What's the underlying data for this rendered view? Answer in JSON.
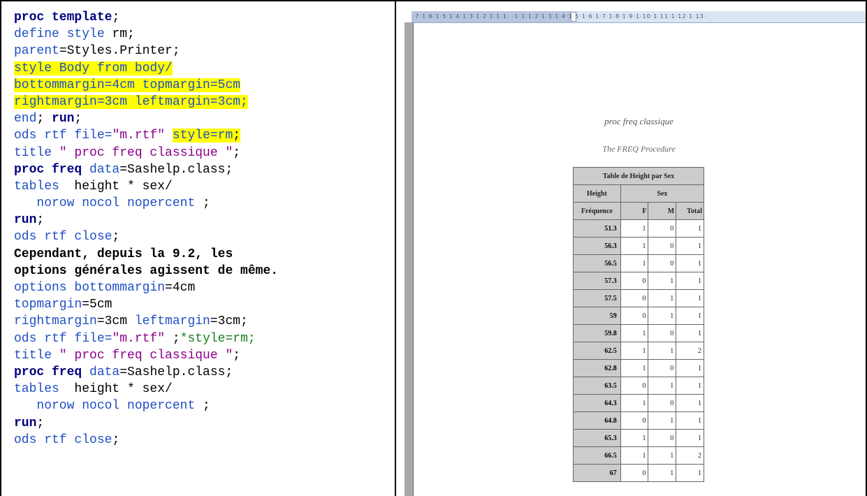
{
  "code_lines": [
    [
      {
        "t": "proc template",
        "c": "k"
      },
      {
        "t": ";",
        "c": ""
      }
    ],
    [
      {
        "t": "define style ",
        "c": "b"
      },
      {
        "t": "rm;",
        "c": ""
      }
    ],
    [
      {
        "t": "parent",
        "c": "b"
      },
      {
        "t": "=Styles.Printer;",
        "c": ""
      }
    ],
    [
      {
        "t": "style Body from body/",
        "c": "b hl"
      }
    ],
    [
      {
        "t": "bottommargin=4cm topmargin=5cm",
        "c": "b hl"
      }
    ],
    [
      {
        "t": "rightmargin=3cm leftmargin=3cm;",
        "c": "b hl"
      }
    ],
    [
      {
        "t": "end",
        "c": "b"
      },
      {
        "t": "; ",
        "c": ""
      },
      {
        "t": "run",
        "c": "k"
      },
      {
        "t": ";",
        "c": ""
      }
    ],
    [
      {
        "t": "ods rtf file=",
        "c": "b"
      },
      {
        "t": "\"m.rtf\"",
        "c": "s"
      },
      {
        "t": " ",
        "c": ""
      },
      {
        "t": "style=rm",
        "c": "b hl"
      },
      {
        "t": ";",
        "c": "hl"
      }
    ],
    [
      {
        "t": "title ",
        "c": "b"
      },
      {
        "t": "\" proc freq classique \"",
        "c": "s"
      },
      {
        "t": ";",
        "c": ""
      }
    ],
    [
      {
        "t": "proc freq",
        "c": "k"
      },
      {
        "t": " data",
        "c": "b"
      },
      {
        "t": "=Sashelp.class;",
        "c": ""
      }
    ],
    [
      {
        "t": "tables",
        "c": "b"
      },
      {
        "t": "  height * sex/",
        "c": ""
      }
    ],
    [
      {
        "t": "   norow nocol nopercent ",
        "c": "b"
      },
      {
        "t": ";",
        "c": ""
      }
    ],
    [
      {
        "t": "run",
        "c": "k"
      },
      {
        "t": ";",
        "c": ""
      }
    ],
    [
      {
        "t": "ods rtf close",
        "c": "b"
      },
      {
        "t": ";",
        "c": ""
      }
    ],
    [
      {
        "t": "Cependant, depuis la 9.2, les",
        "c": "kb"
      }
    ],
    [
      {
        "t": "options générales agissent de même.",
        "c": "kb"
      }
    ],
    [
      {
        "t": "options bottommargin",
        "c": "b"
      },
      {
        "t": "=4cm",
        "c": ""
      }
    ],
    [
      {
        "t": "topmargin",
        "c": "b"
      },
      {
        "t": "=5cm",
        "c": ""
      }
    ],
    [
      {
        "t": "rightmargin",
        "c": "b"
      },
      {
        "t": "=3cm ",
        "c": ""
      },
      {
        "t": "leftmargin",
        "c": "b"
      },
      {
        "t": "=3cm;",
        "c": ""
      }
    ],
    [
      {
        "t": "ods rtf file=",
        "c": "b"
      },
      {
        "t": "\"m.rtf\"",
        "c": "s"
      },
      {
        "t": " ;",
        "c": ""
      },
      {
        "t": "*style=rm;",
        "c": "g"
      }
    ],
    [
      {
        "t": "title ",
        "c": "b"
      },
      {
        "t": "\" proc freq classique \"",
        "c": "s"
      },
      {
        "t": ";",
        "c": ""
      }
    ],
    [
      {
        "t": "proc freq",
        "c": "k"
      },
      {
        "t": " data",
        "c": "b"
      },
      {
        "t": "=Sashelp.class;",
        "c": ""
      }
    ],
    [
      {
        "t": "tables",
        "c": "b"
      },
      {
        "t": "  height * sex/",
        "c": ""
      }
    ],
    [
      {
        "t": "   norow nocol nopercent ",
        "c": "b"
      },
      {
        "t": ";",
        "c": ""
      }
    ],
    [
      {
        "t": "run",
        "c": "k"
      },
      {
        "t": ";",
        "c": ""
      }
    ],
    [
      {
        "t": "ods rtf close",
        "c": "b"
      },
      {
        "t": ";",
        "c": ""
      }
    ]
  ],
  "ruler_text": "·7·1·6·1·5·1·4·1·3·1·2·1·1·1· ·1·1·1·2·1·3·1·4·1·5·1·6·1·7·1·8·1·9·1·10·1·11·1·12·1·13·",
  "doc": {
    "title": "proc freq classique",
    "subtitle": "The FREQ Procedure",
    "table_caption": "Table de Height par Sex",
    "row_header": "Height",
    "col_header": "Sex",
    "stat_label": "Fréquence",
    "columns": [
      "F",
      "M",
      "Total"
    ],
    "rows": [
      {
        "h": "51.3",
        "f": "1",
        "m": "0",
        "t": "1"
      },
      {
        "h": "56.3",
        "f": "1",
        "m": "0",
        "t": "1"
      },
      {
        "h": "56.5",
        "f": "1",
        "m": "0",
        "t": "1"
      },
      {
        "h": "57.3",
        "f": "0",
        "m": "1",
        "t": "1"
      },
      {
        "h": "57.5",
        "f": "0",
        "m": "1",
        "t": "1"
      },
      {
        "h": "59",
        "f": "0",
        "m": "1",
        "t": "1"
      },
      {
        "h": "59.8",
        "f": "1",
        "m": "0",
        "t": "1"
      },
      {
        "h": "62.5",
        "f": "1",
        "m": "1",
        "t": "2"
      },
      {
        "h": "62.8",
        "f": "1",
        "m": "0",
        "t": "1"
      },
      {
        "h": "63.5",
        "f": "0",
        "m": "1",
        "t": "1"
      },
      {
        "h": "64.3",
        "f": "1",
        "m": "0",
        "t": "1"
      },
      {
        "h": "64.8",
        "f": "0",
        "m": "1",
        "t": "1"
      },
      {
        "h": "65.3",
        "f": "1",
        "m": "0",
        "t": "1"
      },
      {
        "h": "66.5",
        "f": "1",
        "m": "1",
        "t": "2"
      },
      {
        "h": "67",
        "f": "0",
        "m": "1",
        "t": "1"
      }
    ]
  }
}
